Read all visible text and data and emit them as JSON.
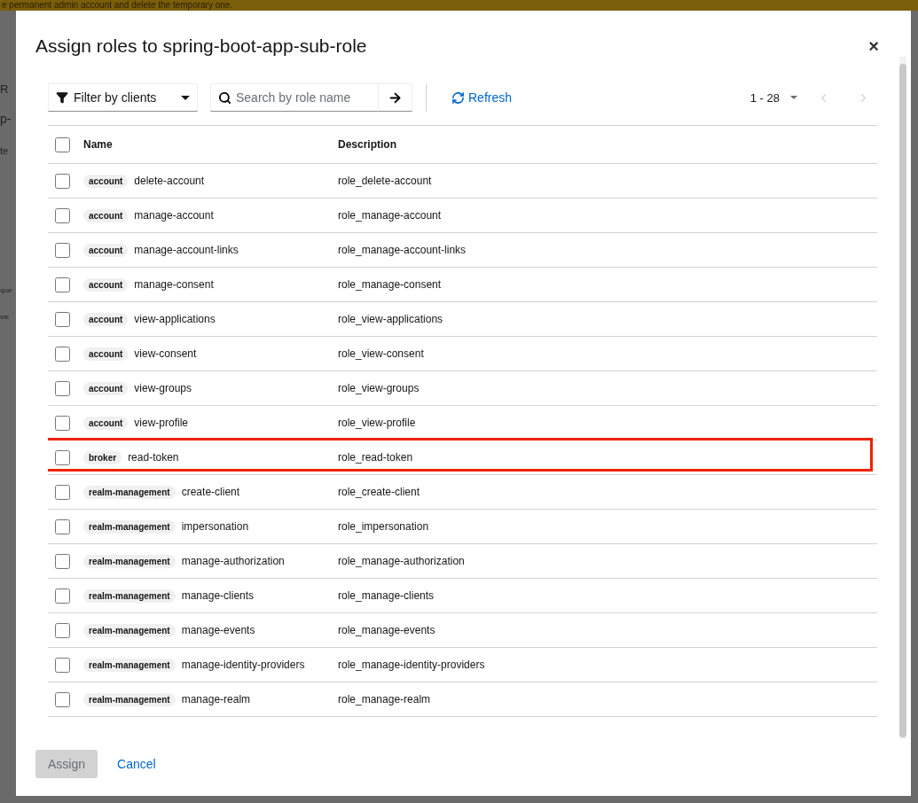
{
  "banner": {
    "text": "e permanent admin account and delete the temporary one."
  },
  "background_fragments": [
    "R",
    "p-",
    "te",
    "que",
    "vie"
  ],
  "dialog": {
    "title": "Assign roles to spring-boot-app-sub-role",
    "close": "×"
  },
  "toolbar": {
    "filter": {
      "label": "Filter by clients"
    },
    "search": {
      "placeholder": "Search by role name"
    },
    "refresh": "Refresh",
    "pagination": {
      "range": "1 - 28",
      "prev_disabled": true,
      "next_disabled": true
    }
  },
  "table": {
    "columns": [
      "Name",
      "Description"
    ],
    "all_checked": false,
    "rows": [
      {
        "client": "account",
        "name": "delete-account",
        "description": "role_delete-account",
        "checked": false,
        "highlighted": false
      },
      {
        "client": "account",
        "name": "manage-account",
        "description": "role_manage-account",
        "checked": false,
        "highlighted": false
      },
      {
        "client": "account",
        "name": "manage-account-links",
        "description": "role_manage-account-links",
        "checked": false,
        "highlighted": false
      },
      {
        "client": "account",
        "name": "manage-consent",
        "description": "role_manage-consent",
        "checked": false,
        "highlighted": false
      },
      {
        "client": "account",
        "name": "view-applications",
        "description": "role_view-applications",
        "checked": false,
        "highlighted": false
      },
      {
        "client": "account",
        "name": "view-consent",
        "description": "role_view-consent",
        "checked": false,
        "highlighted": false
      },
      {
        "client": "account",
        "name": "view-groups",
        "description": "role_view-groups",
        "checked": false,
        "highlighted": false
      },
      {
        "client": "account",
        "name": "view-profile",
        "description": "role_view-profile",
        "checked": false,
        "highlighted": false
      },
      {
        "client": "broker",
        "name": "read-token",
        "description": "role_read-token",
        "checked": false,
        "highlighted": true
      },
      {
        "client": "realm-management",
        "name": "create-client",
        "description": "role_create-client",
        "checked": false,
        "highlighted": false
      },
      {
        "client": "realm-management",
        "name": "impersonation",
        "description": "role_impersonation",
        "checked": false,
        "highlighted": false
      },
      {
        "client": "realm-management",
        "name": "manage-authorization",
        "description": "role_manage-authorization",
        "checked": false,
        "highlighted": false
      },
      {
        "client": "realm-management",
        "name": "manage-clients",
        "description": "role_manage-clients",
        "checked": false,
        "highlighted": false
      },
      {
        "client": "realm-management",
        "name": "manage-events",
        "description": "role_manage-events",
        "checked": false,
        "highlighted": false
      },
      {
        "client": "realm-management",
        "name": "manage-identity-providers",
        "description": "role_manage-identity-providers",
        "checked": false,
        "highlighted": false
      },
      {
        "client": "realm-management",
        "name": "manage-realm",
        "description": "role_manage-realm",
        "checked": false,
        "highlighted": false
      }
    ]
  },
  "footer": {
    "assign": {
      "label": "Assign",
      "disabled": true
    },
    "cancel": "Cancel"
  }
}
